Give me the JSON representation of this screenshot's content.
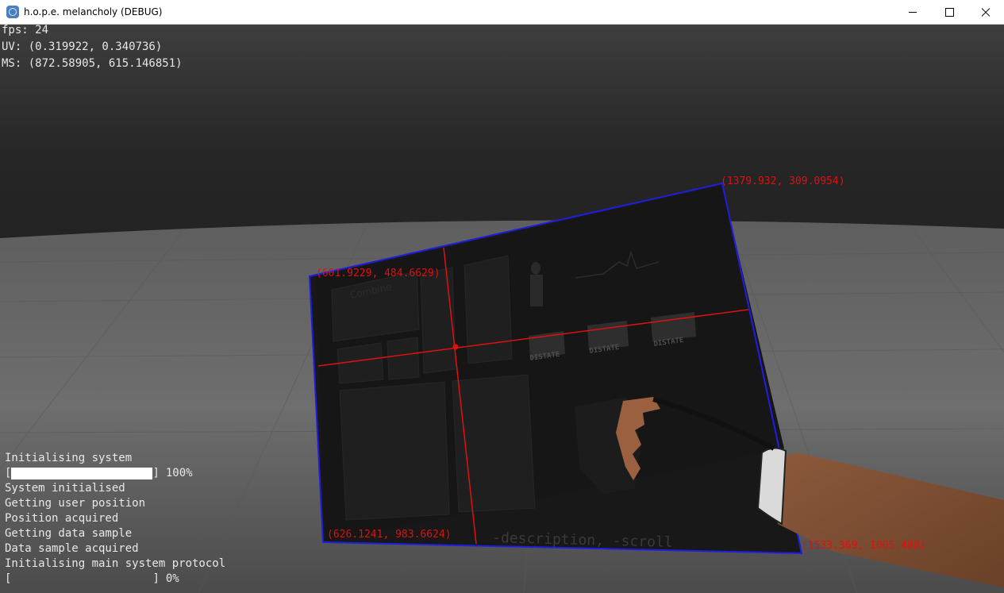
{
  "window": {
    "title": "h.o.p.e. melancholy (DEBUG)",
    "controls": [
      "minimize",
      "maximize",
      "close"
    ]
  },
  "debug": {
    "fps": "fps: 24",
    "uv": "UV: (0.319922, 0.340736)",
    "ms": "MS: (872.58905, 615.146851)"
  },
  "corners": {
    "top_right": "(1379.932, 309.0954)",
    "top_left": "(601.9229, 484.6629)",
    "bottom_left": "(626.1241, 983.6624)",
    "bottom_right": "(1533.369, 1005.488)"
  },
  "tablet": {
    "header": "Combine",
    "badges": [
      "DISTATE",
      "DISTATE",
      "DISTATE"
    ],
    "footer": "-description, -scroll"
  },
  "log": {
    "lines": [
      {
        "text": "Initialising system"
      },
      {
        "bar": true,
        "open": "[",
        "close": "]",
        "label": "100%",
        "progress": 1.0
      },
      {
        "text": "System initialised"
      },
      {
        "text": "Getting user position"
      },
      {
        "text": "Position acquired"
      },
      {
        "text": "Getting data sample"
      },
      {
        "text": "Data sample acquired"
      },
      {
        "text": "Initialising main system protocol"
      },
      {
        "bar": true,
        "open": "[",
        "close": "]",
        "label": "0%",
        "progress": 0.0
      }
    ]
  },
  "colors": {
    "sky_top": "#3e3e3e",
    "floor": "#7a7a7a",
    "tablet": "#181818",
    "outline": "#1e1ee0",
    "crosshair": "#e01010"
  }
}
